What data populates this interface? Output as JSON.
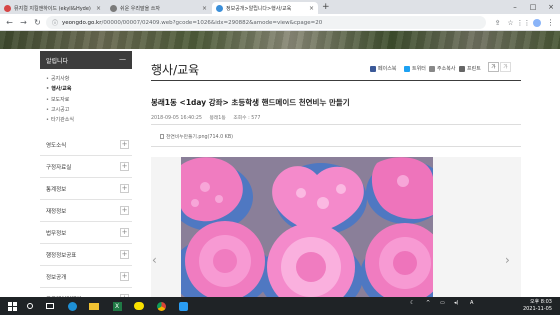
{
  "browser": {
    "tabs": [
      {
        "label": "뮤지컬 지킬앤하이드 (ekyll&Hyde) ...",
        "active": false,
        "favicon_color": "#d64545"
      },
      {
        "label": "쉬운 우리말을 쓰자",
        "active": false,
        "favicon_color": "#7a7a7a"
      },
      {
        "label": "정보공개>알립니다>행사/교육",
        "active": true,
        "favicon_color": "#3b8fd9"
      }
    ],
    "url_host": "yeongdo.go.kr",
    "url_path": "/00000/00007/02409.web?gcode=1026&idx=290882&amode=view&cpage=20"
  },
  "sidebar": {
    "header": "알립니다",
    "header_toggle": "—",
    "subitems": [
      {
        "label": "공지사항",
        "active": false
      },
      {
        "label": "행사/교육",
        "active": true
      },
      {
        "label": "보도자료",
        "active": false
      },
      {
        "label": "고시공고",
        "active": false
      },
      {
        "label": "타기관소식",
        "active": false
      }
    ],
    "menu": [
      "영도소식",
      "구정자료실",
      "통계정보",
      "재정정보",
      "법무정보",
      "행정정보공표",
      "정보공개",
      "공공데이터개방"
    ],
    "plus": "+"
  },
  "content": {
    "page_title": "행사/교육",
    "share": [
      "페이스북",
      "트위터",
      "주소복사",
      "프린트"
    ],
    "size_buttons": [
      "가",
      "가"
    ],
    "article_title": "봉래1동 <1day 강좌> 초등학생 핸드메이드 천연비누 만들기",
    "meta_date": "2018-09-05 16:40:25",
    "meta_author": "봉래1동",
    "meta_views": "조회수 : 577",
    "attachment": "천연비누만들기.png(714.0 KB)",
    "prev_arrow": "‹",
    "next_arrow": "›"
  },
  "taskbar": {
    "time": "오후 8:03",
    "date": "2021-11-05"
  },
  "colors": {
    "soap_pink": "#f07cc0",
    "soap_blue": "#4f78c2",
    "sidebar_dark": "#3c3c3c"
  }
}
